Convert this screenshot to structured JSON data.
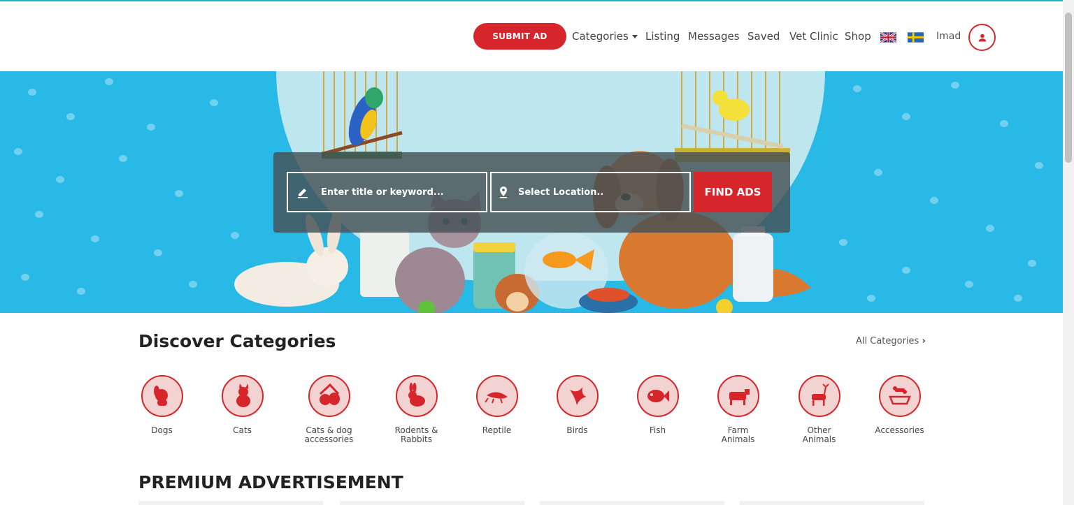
{
  "nav": {
    "submit_label": "SUBMIT AD",
    "items": [
      "Categories",
      "Listing",
      "Messages",
      "Saved",
      "Vet Clinic",
      "Shop"
    ],
    "user_name": "Imad"
  },
  "search": {
    "keyword_placeholder": "Enter title or keyword...",
    "location_placeholder": "Select Location..",
    "button_label": "FIND ADS"
  },
  "categories": {
    "title": "Discover Categories",
    "all_link": "All Categories",
    "items": [
      {
        "label": "Dogs",
        "icon": "dog-icon"
      },
      {
        "label": "Cats",
        "icon": "cat-icon"
      },
      {
        "label": "Cats & dog accessories",
        "icon": "pets-accessories-icon"
      },
      {
        "label": "Rodents & Rabbits",
        "icon": "rabbit-icon"
      },
      {
        "label": "Reptile",
        "icon": "reptile-icon"
      },
      {
        "label": "Birds",
        "icon": "bird-icon"
      },
      {
        "label": "Fish",
        "icon": "fish-icon"
      },
      {
        "label": "Farm Animals",
        "icon": "farm-animal-icon"
      },
      {
        "label": "Other Animals",
        "icon": "deer-icon"
      },
      {
        "label": "Accessories",
        "icon": "bowl-bone-icon"
      }
    ]
  },
  "premium": {
    "title": "PREMIUM ADVERTISEMENT"
  },
  "colors": {
    "accent": "#d7262b",
    "hero": "#29b9e6"
  }
}
